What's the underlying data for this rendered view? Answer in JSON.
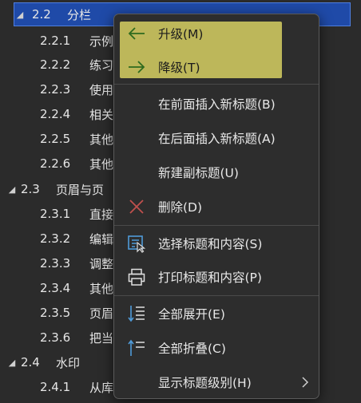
{
  "outline": [
    {
      "id": "r0",
      "level": 2,
      "num": "2.2",
      "label": "分栏",
      "expanded": true,
      "selected": true
    },
    {
      "id": "r1",
      "level": 3,
      "num": "2.2.1",
      "label": "示例"
    },
    {
      "id": "r2",
      "level": 3,
      "num": "2.2.2",
      "label": "练习"
    },
    {
      "id": "r3",
      "level": 3,
      "num": "2.2.3",
      "label": "使用"
    },
    {
      "id": "r4",
      "level": 3,
      "num": "2.2.4",
      "label": "相关"
    },
    {
      "id": "r5",
      "level": 3,
      "num": "2.2.5",
      "label": "其他"
    },
    {
      "id": "r6",
      "level": 3,
      "num": "2.2.6",
      "label": "其他"
    },
    {
      "id": "r7",
      "level": 2,
      "num": "2.3",
      "label": "页眉与页",
      "expanded": true
    },
    {
      "id": "r8",
      "level": 3,
      "num": "2.3.1",
      "label": "直接"
    },
    {
      "id": "r9",
      "level": 3,
      "num": "2.3.2",
      "label": "编辑"
    },
    {
      "id": "r10",
      "level": 3,
      "num": "2.3.3",
      "label": "调整"
    },
    {
      "id": "r11",
      "level": 3,
      "num": "2.3.4",
      "label": "其他"
    },
    {
      "id": "r12",
      "level": 3,
      "num": "2.3.5",
      "label": "页眉"
    },
    {
      "id": "r13",
      "level": 3,
      "num": "2.3.6",
      "label": "把当"
    },
    {
      "id": "r14",
      "level": 2,
      "num": "2.4",
      "label": "水印",
      "expanded": true
    },
    {
      "id": "r15",
      "level": 3,
      "num": "2.4.1",
      "label": "从库"
    }
  ],
  "menu": {
    "promote": "升级(M)",
    "demote": "降级(T)",
    "insert_before": "在前面插入新标题(B)",
    "insert_after": "在后面插入新标题(A)",
    "new_subheading": "新建副标题(U)",
    "delete": "删除(D)",
    "select_heading_content": "选择标题和内容(S)",
    "print_heading_content": "打印标题和内容(P)",
    "expand_all": "全部展开(E)",
    "collapse_all": "全部折叠(C)",
    "show_heading_levels": "显示标题级别(H)"
  },
  "colors": {
    "highlight": "#bdb75a",
    "arrow_green": "#2e6b1e",
    "delete_red": "#c0504d",
    "icon_blue": "#4f9bd9"
  }
}
